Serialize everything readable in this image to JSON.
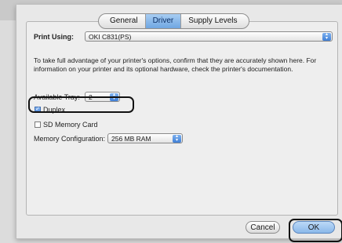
{
  "tabs": [
    {
      "label": "General",
      "selected": false
    },
    {
      "label": "Driver",
      "selected": true
    },
    {
      "label": "Supply Levels",
      "selected": false
    }
  ],
  "print_using": {
    "label": "Print Using:",
    "value": "OKI C831(PS)"
  },
  "instructions": "To take full advantage of your printer's options, confirm that they are accurately shown here. For information on your printer and its optional hardware, check the printer's documentation.",
  "available_tray": {
    "label": "Available Tray:",
    "value": "2"
  },
  "duplex": {
    "label": "Duplex",
    "checked": true
  },
  "sd_memory_card": {
    "label": "SD Memory Card",
    "checked": false
  },
  "memory_configuration": {
    "label": "Memory Configuration:",
    "value": "256 MB RAM"
  },
  "buttons": {
    "cancel": "Cancel",
    "ok": "OK"
  },
  "colors": {
    "tab_selected": "#6fa6e2",
    "highlight_outline": "#111111"
  }
}
